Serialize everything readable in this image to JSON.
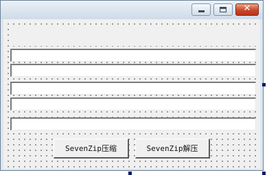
{
  "window": {
    "title": "",
    "controls": {
      "minimize": "minimize-icon",
      "maximize": "maximize-icon",
      "close": "close-icon",
      "close_glyph": "✕"
    }
  },
  "form": {
    "status_label": "",
    "textboxes": [
      "",
      "",
      "",
      "",
      ""
    ]
  },
  "buttons": {
    "compress_label": "SevenZip压缩",
    "extract_label": "SevenZip解压"
  },
  "colors": {
    "close_button": "#c9472a",
    "titlebar": "#dde6ef",
    "form_background": "#f0f0f0"
  }
}
